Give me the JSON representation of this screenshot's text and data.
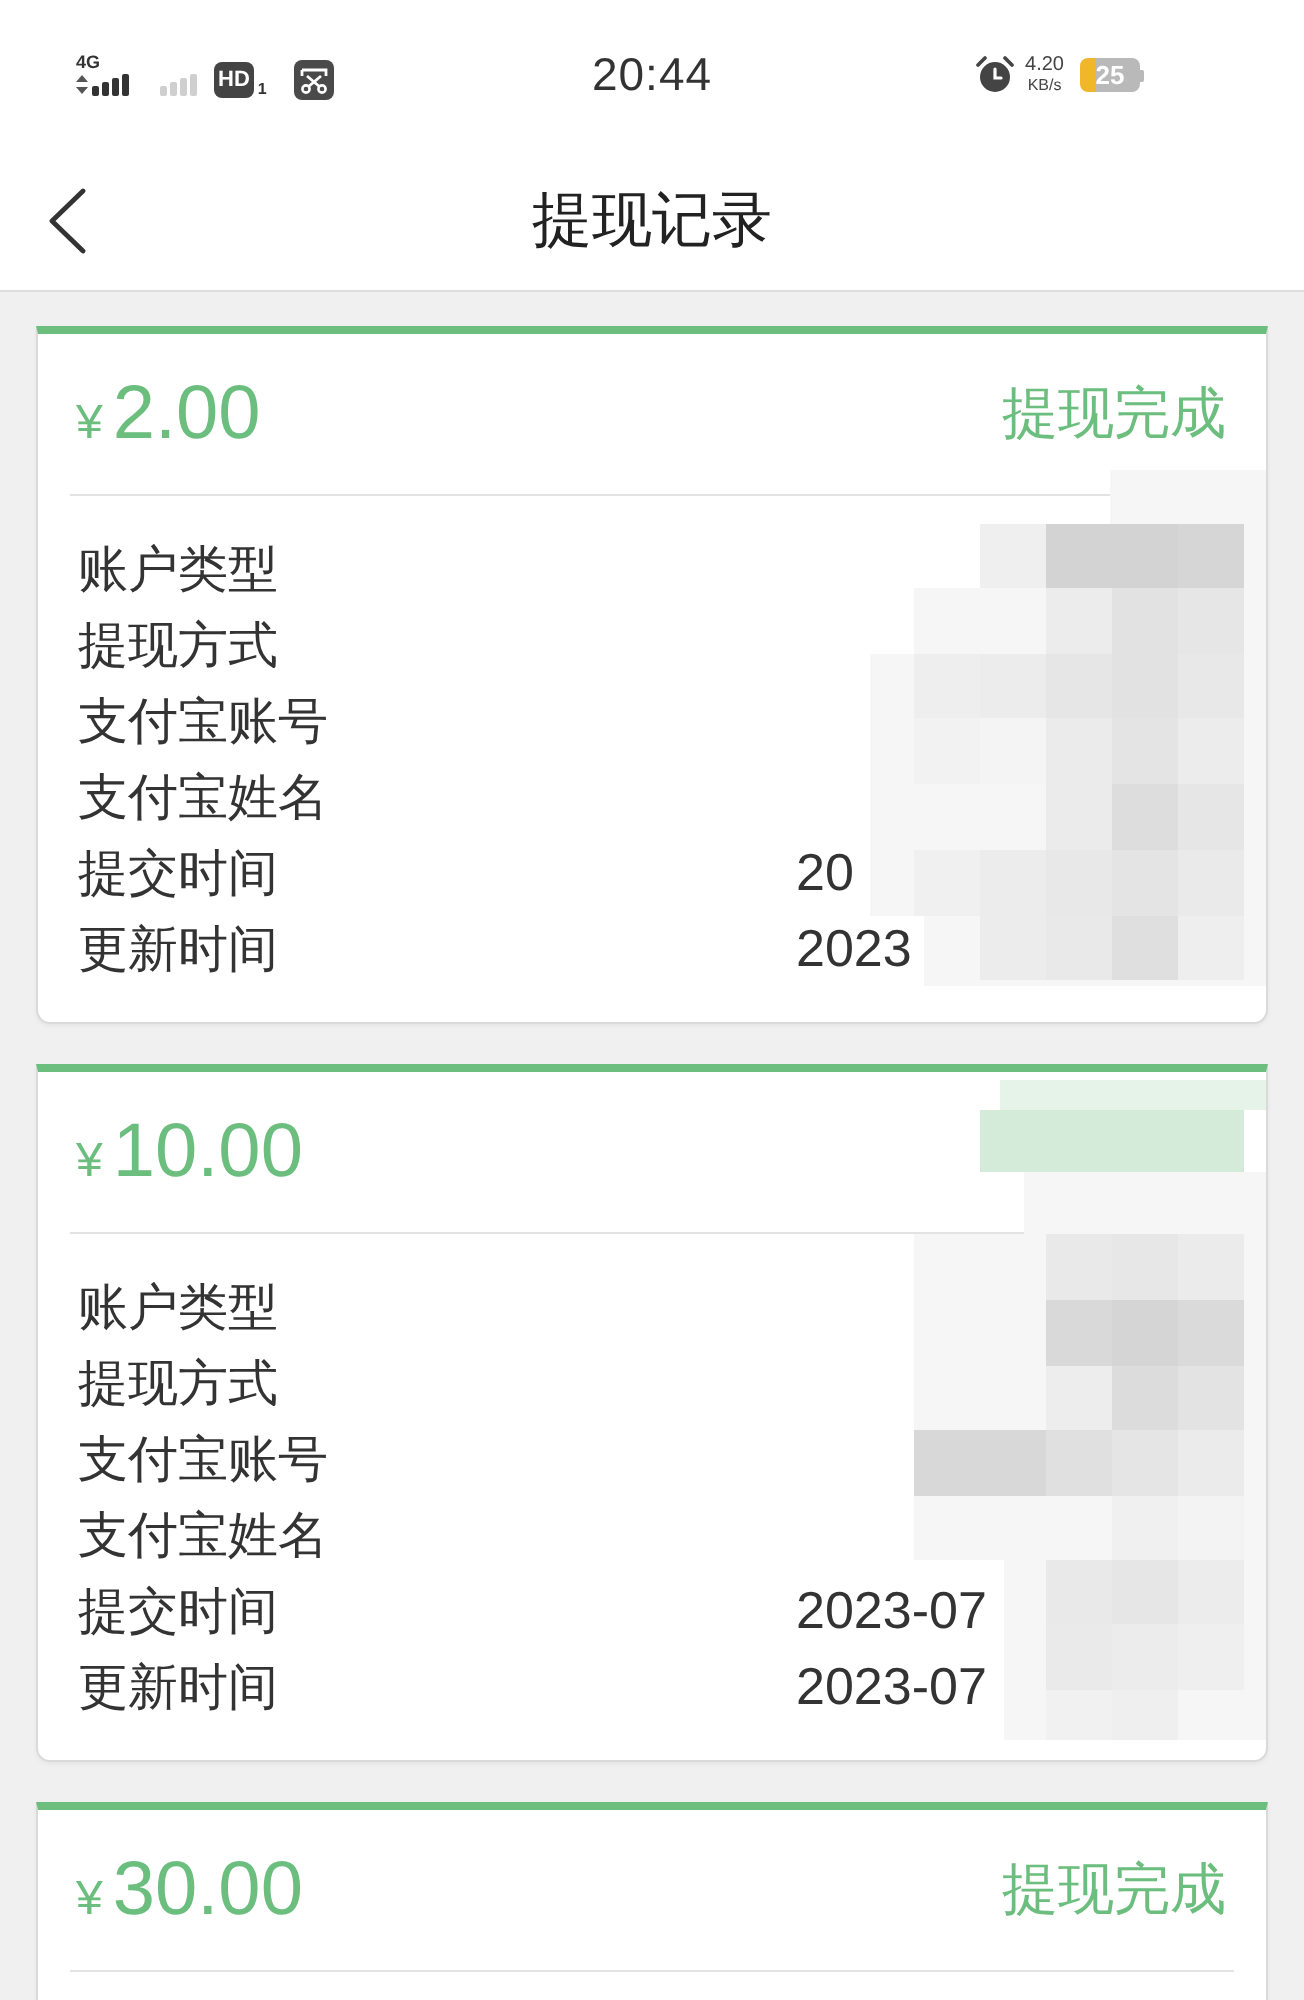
{
  "status_bar": {
    "network_type": "4G",
    "hd_badge": "HD",
    "sim_slot": "1",
    "time": "20:44",
    "speed_value": "4.20",
    "speed_unit": "KB/s",
    "battery": "25"
  },
  "nav": {
    "title": "提现记录"
  },
  "records": [
    {
      "currency": "¥",
      "amount": "2.00",
      "status": "提现完成",
      "redacted": true,
      "fields": [
        {
          "label": "账户类型"
        },
        {
          "label": "提现方式"
        },
        {
          "label": "支付宝账号"
        },
        {
          "label": "支付宝姓名"
        },
        {
          "label": "提交时间",
          "value": "20"
        },
        {
          "label": "更新时间",
          "value": "2023"
        }
      ]
    },
    {
      "currency": "¥",
      "amount": "10.00",
      "redacted": true,
      "fields": [
        {
          "label": "账户类型"
        },
        {
          "label": "提现方式"
        },
        {
          "label": "支付宝账号"
        },
        {
          "label": "支付宝姓名"
        },
        {
          "label": "提交时间",
          "value": "2023-07"
        },
        {
          "label": "更新时间",
          "value": "2023-07"
        }
      ]
    },
    {
      "currency": "¥",
      "amount": "30.00",
      "status": "提现完成",
      "redacted": false
    }
  ]
}
